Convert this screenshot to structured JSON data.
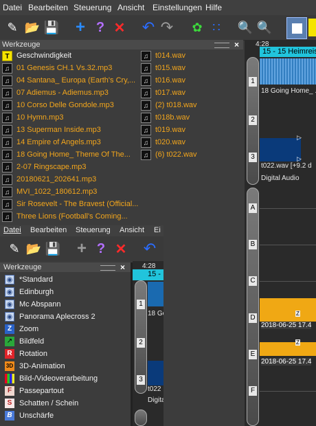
{
  "menu": [
    "Datei",
    "Bearbeiten",
    "Steuerung",
    "Ansicht",
    "Einstellungen",
    "Hilfe"
  ],
  "menu2": [
    "Datei",
    "Bearbeiten",
    "Steuerung",
    "Ansicht",
    "Ei"
  ],
  "panel1": {
    "title": "Werkzeuge",
    "files_left": [
      {
        "label": "Geschwindigkeit",
        "icon": "T",
        "type": "title"
      },
      {
        "label": "01 Genesis CH.1 Vs.32.mp3",
        "icon": "music",
        "type": "audio"
      },
      {
        "label": "04 Santana_ Europa (Earth's Cry,...",
        "icon": "music",
        "type": "audio"
      },
      {
        "label": "07 Adiemus - Adiemus.mp3",
        "icon": "music",
        "type": "audio"
      },
      {
        "label": "10 Corso Delle Gondole.mp3",
        "icon": "music",
        "type": "audio"
      },
      {
        "label": "10 Hymn.mp3",
        "icon": "music",
        "type": "audio"
      },
      {
        "label": "13 Superman Inside.mp3",
        "icon": "music",
        "type": "audio"
      },
      {
        "label": "14 Empire of Angels.mp3",
        "icon": "music",
        "type": "audio"
      },
      {
        "label": "18 Going Home_ Theme Of The...",
        "icon": "music",
        "type": "audio"
      },
      {
        "label": "2-07 Ringscape.mp3",
        "icon": "music",
        "type": "audio"
      },
      {
        "label": "20180621_202641.mp3",
        "icon": "music",
        "type": "audio"
      },
      {
        "label": "MVI_1022_180612.mp3",
        "icon": "music",
        "type": "audio"
      },
      {
        "label": "Sir Rosevelt - The Bravest (Official...",
        "icon": "music",
        "type": "audio"
      },
      {
        "label": "Three Lions (Football's Coming...",
        "icon": "music",
        "type": "audio"
      }
    ],
    "files_right": [
      "t014.wav",
      "t015.wav",
      "t016.wav",
      "t017.wav",
      "(2) t018.wav",
      "t018b.wav",
      "t019.wav",
      "t020.wav",
      "(6) t022.wav"
    ]
  },
  "panel2": {
    "title": "Werkzeuge",
    "tools": [
      {
        "label": "*Standard",
        "icon": "effect-icon"
      },
      {
        "label": "Edinburgh",
        "icon": "effect-icon"
      },
      {
        "label": "Mc Abspann",
        "icon": "effect-icon"
      },
      {
        "label": "Panorama Aplecross 2",
        "icon": "effect-icon"
      },
      {
        "label": "Zoom",
        "icon": "zoom-icon"
      },
      {
        "label": "Bildfeld",
        "icon": "picture-field-icon"
      },
      {
        "label": "Rotation",
        "icon": "rotation-icon"
      },
      {
        "label": "3D-Animation",
        "icon": "3d-icon"
      },
      {
        "label": "Bild-/Videoverarbeitung",
        "icon": "color-bars-icon"
      },
      {
        "label": "Passepartout",
        "icon": "passepartout-icon"
      },
      {
        "label": "Schatten / Schein",
        "icon": "shadow-icon"
      },
      {
        "label": "Unschärfe",
        "icon": "blur-icon"
      }
    ]
  },
  "timeline1": {
    "time": "4:28",
    "clip_title": "15 - 15 Heimreise",
    "clip2_title": "18 Going Home_ ...",
    "clip3_title": "t022.wav [+9.2 d",
    "track_label": "Digital Audio",
    "track_numbers": [
      "1",
      "2",
      "3"
    ],
    "rows": [
      "A",
      "B",
      "C",
      "D",
      "E",
      "F"
    ],
    "clip_d": "2018-06-25 17.4",
    "clip_e": "2018-06-25 17.4"
  },
  "timeline2": {
    "time": "4:28",
    "clip_title": "15 -",
    "clip2_title": "18 Go",
    "clip3_title": "t022",
    "track_label": "Digita",
    "track_numbers": [
      "1",
      "2",
      "3"
    ]
  },
  "colors": {
    "accent_orange": "#f3a61c",
    "cyan": "#21c4dc",
    "blue_wave": "#0a3a7a"
  }
}
